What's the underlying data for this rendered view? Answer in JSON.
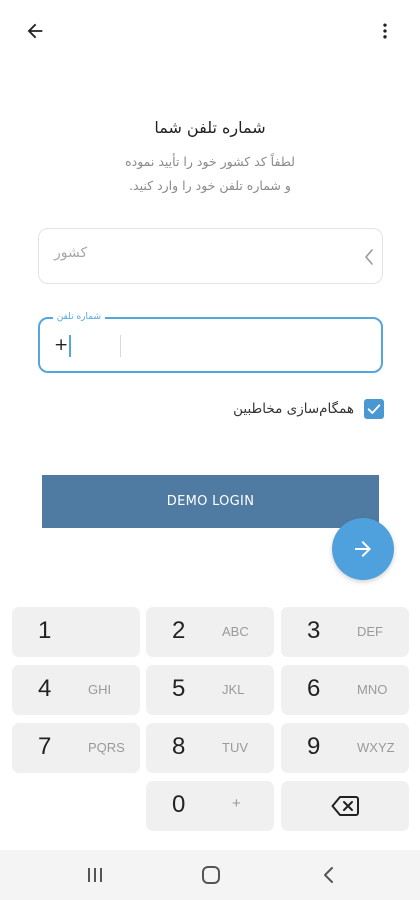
{
  "header": {
    "back_icon": "arrow-left-icon",
    "menu_icon": "more-vert-icon"
  },
  "main": {
    "title": "شماره تلفن شما",
    "subtitle_line1": "لطفاً کد کشور خود را تأیید نموده",
    "subtitle_line2": "و شماره تلفن خود را وارد کنید.",
    "country_placeholder": "کشور",
    "phone_label": "شماره تلفن",
    "phone_prefix": "+",
    "phone_value": "",
    "sync_contacts_label": "همگام‌سازی مخاطبین",
    "sync_contacts_checked": true,
    "demo_login_label": "DEMO LOGIN"
  },
  "keypad": {
    "keys": [
      {
        "digit": "1",
        "letters": ""
      },
      {
        "digit": "2",
        "letters": "ABC"
      },
      {
        "digit": "3",
        "letters": "DEF"
      },
      {
        "digit": "4",
        "letters": "GHI"
      },
      {
        "digit": "5",
        "letters": "JKL"
      },
      {
        "digit": "6",
        "letters": "MNO"
      },
      {
        "digit": "7",
        "letters": "PQRS"
      },
      {
        "digit": "8",
        "letters": "TUV"
      },
      {
        "digit": "9",
        "letters": "WXYZ"
      },
      {
        "digit": "0",
        "letters": "+"
      }
    ],
    "backspace_icon": "backspace-icon"
  },
  "colors": {
    "accent": "#4ea1dc",
    "demo_button": "#4f7ba3",
    "field_focus": "#55a6dd"
  }
}
